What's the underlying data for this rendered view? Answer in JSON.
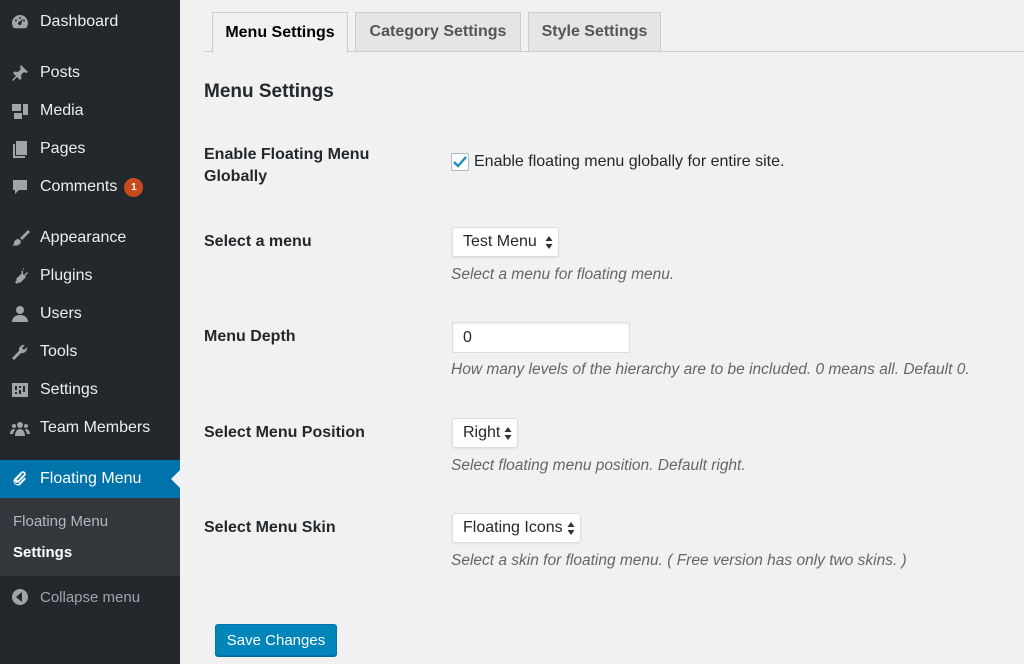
{
  "sidebar": {
    "items": [
      {
        "label": "Dashboard",
        "icon": "dashboard-icon"
      },
      {
        "label": "Posts",
        "icon": "pin-icon"
      },
      {
        "label": "Media",
        "icon": "media-icon"
      },
      {
        "label": "Pages",
        "icon": "pages-icon"
      },
      {
        "label": "Comments",
        "icon": "comment-icon",
        "badge": "1"
      },
      {
        "label": "Appearance",
        "icon": "brush-icon"
      },
      {
        "label": "Plugins",
        "icon": "plug-icon"
      },
      {
        "label": "Users",
        "icon": "user-icon"
      },
      {
        "label": "Tools",
        "icon": "wrench-icon"
      },
      {
        "label": "Settings",
        "icon": "settings-icon"
      },
      {
        "label": "Team Members",
        "icon": "group-icon"
      },
      {
        "label": "Floating Menu",
        "icon": "paperclip-icon",
        "active": true
      }
    ],
    "submenu": [
      {
        "label": "Floating Menu"
      },
      {
        "label": "Settings",
        "current": true
      }
    ],
    "collapse_label": "Collapse menu"
  },
  "tabs": [
    {
      "label": "Menu Settings",
      "active": true
    },
    {
      "label": "Category Settings"
    },
    {
      "label": "Style Settings"
    }
  ],
  "main": {
    "title": "Menu Settings",
    "fields": {
      "enable": {
        "label": "Enable Floating Menu Globally",
        "checkbox_label": "Enable floating menu globally for entire site.",
        "checked": true
      },
      "menu": {
        "label": "Select a menu",
        "value": "Test Menu",
        "description": "Select a menu for floating menu."
      },
      "depth": {
        "label": "Menu Depth",
        "value": "0",
        "description": "How many levels of the hierarchy are to be included. 0 means all. Default 0."
      },
      "position": {
        "label": "Select Menu Position",
        "value": "Right",
        "description": "Select floating menu position. Default right."
      },
      "skin": {
        "label": "Select Menu Skin",
        "value": "Floating Icons",
        "description": "Select a skin for floating menu. ( Free version has only two skins. )"
      }
    },
    "save_label": "Save Changes"
  },
  "colors": {
    "sidebar_bg": "#23282d",
    "active_blue": "#0073aa",
    "button_blue": "#0085ba",
    "badge_orange": "#ca4a1f"
  }
}
